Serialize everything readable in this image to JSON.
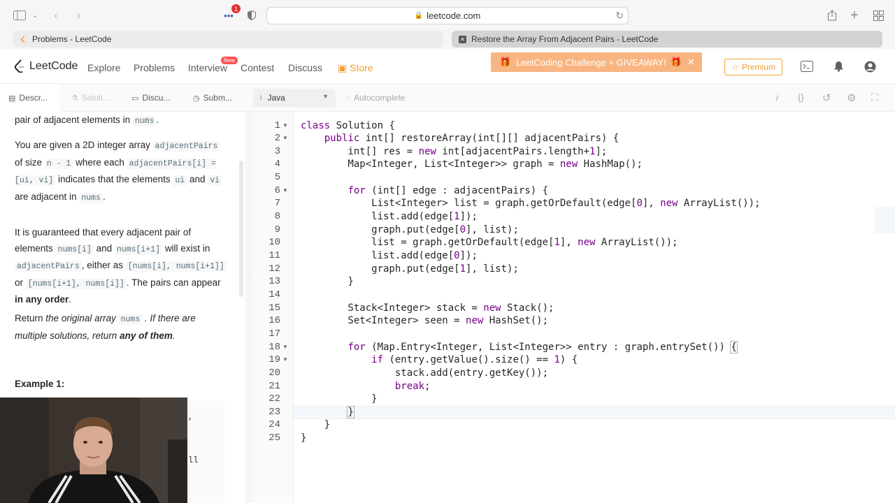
{
  "browser": {
    "url": "leetcode.com",
    "notification_count": "1",
    "tabs": [
      {
        "title": "Problems - LeetCode"
      },
      {
        "title": "Restore the Array From Adjacent Pairs - LeetCode"
      }
    ]
  },
  "nav": {
    "logo": "LeetCode",
    "links": [
      "Explore",
      "Problems",
      "Interview",
      "Contest",
      "Discuss",
      "Store"
    ],
    "new_badge": "New",
    "promo": "LeetCoding Challenge + GIVEAWAY!",
    "premium": "Premium"
  },
  "subbar": {
    "tabs": [
      "Descr...",
      "Soluti...",
      "Discu...",
      "Subm..."
    ],
    "language": "Java",
    "autocomplete": "Autocomplete"
  },
  "description": {
    "p0_a": "pair of adjacent elements in",
    "p0_code": "nums",
    "p0_b": ".",
    "p1_a": "You are given a 2D integer array",
    "p1_code1": "adjacentPairs",
    "p1_b": "of size",
    "p1_code2": "n - 1",
    "p1_c": "where each",
    "p1_code3": "adjacentPairs[i] = [ui, vi]",
    "p1_d": "indicates that the elements",
    "p1_code4": "ui",
    "p1_e": "and",
    "p1_code5": "vi",
    "p1_f": "are adjacent in",
    "p1_code6": "nums",
    "p1_g": ".",
    "p2_a": "It is guaranteed that every adjacent pair of elements",
    "p2_code1": "nums[i]",
    "p2_b": "and",
    "p2_code2": "nums[i+1]",
    "p2_c": "will exist in",
    "p2_code3": "adjacentPairs",
    "p2_d": ", either as",
    "p2_code4": "[nums[i], nums[i+1]]",
    "p2_e": "or",
    "p2_code5": "[nums[i+1], nums[i]]",
    "p2_f": ". The pairs can appear",
    "p2_strong": "in any order",
    "p2_g": ".",
    "p3_a": "Return",
    "p3_em1": "the original array",
    "p3_code": "nums",
    "p3_em2": ". If there are multiple solutions, return",
    "p3_strong": "any of them",
    "p3_b": ".",
    "example_title": "Example 1:",
    "ex_frag1": ",",
    "ex_frag2": "ll"
  },
  "editor": {
    "line_numbers": [
      "1",
      "2",
      "3",
      "4",
      "5",
      "6",
      "7",
      "8",
      "9",
      "10",
      "11",
      "12",
      "13",
      "14",
      "15",
      "16",
      "17",
      "18",
      "19",
      "20",
      "21",
      "22",
      "23",
      "24",
      "25"
    ],
    "lines": [
      "class Solution {",
      "    public int[] restoreArray(int[][] adjacentPairs) {",
      "        int[] res = new int[adjacentPairs.length+1];",
      "        Map<Integer, List<Integer>> graph = new HashMap();",
      "",
      "        for (int[] edge : adjacentPairs) {",
      "            List<Integer> list = graph.getOrDefault(edge[0], new ArrayList());",
      "            list.add(edge[1]);",
      "            graph.put(edge[0], list);",
      "            list = graph.getOrDefault(edge[1], new ArrayList());",
      "            list.add(edge[0]);",
      "            graph.put(edge[1], list);",
      "        }",
      "",
      "        Stack<Integer> stack = new Stack();",
      "        Set<Integer> seen = new HashSet();",
      "",
      "        for (Map.Entry<Integer, List<Integer>> entry : graph.entrySet()) {",
      "            if (entry.getValue().size() == 1) {",
      "                stack.add(entry.getKey());",
      "                break;",
      "            }",
      "        }",
      "    }",
      "}"
    ]
  }
}
